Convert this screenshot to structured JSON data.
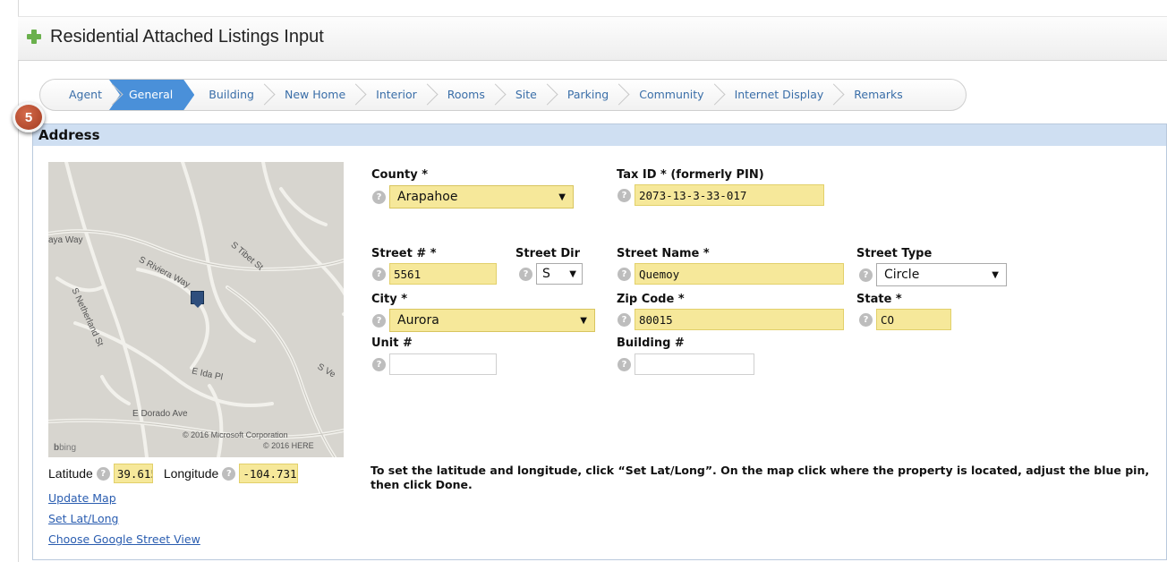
{
  "page": {
    "title": "Residential Attached Listings Input"
  },
  "tabs": [
    {
      "label": "Agent",
      "active": false
    },
    {
      "label": "General",
      "active": true
    },
    {
      "label": "Building",
      "active": false
    },
    {
      "label": "New Home",
      "active": false
    },
    {
      "label": "Interior",
      "active": false
    },
    {
      "label": "Rooms",
      "active": false
    },
    {
      "label": "Site",
      "active": false
    },
    {
      "label": "Parking",
      "active": false
    },
    {
      "label": "Community",
      "active": false
    },
    {
      "label": "Internet Display",
      "active": false
    },
    {
      "label": "Remarks",
      "active": false
    }
  ],
  "step_badge": "5",
  "section": {
    "title": "Address"
  },
  "map": {
    "labels": {
      "aya_way": "aya Way",
      "s_riviera_way": "S Riviera Way",
      "s_tibet_st": "S Tibet St",
      "s_netherland_st": "S Netherland St",
      "e_ida_pl": "E Ida Pl",
      "s_ve": "S Ve",
      "e_dorado_ave": "E Dorado Ave",
      "copyright_ms": "© 2016 Microsoft Corporation",
      "copyright_here": "© 2016 HERE",
      "bing": "bing"
    },
    "background_color": "#d7d5cf"
  },
  "fields": {
    "county": {
      "label": "County *",
      "value": "Arapahoe"
    },
    "tax_id": {
      "label": "Tax ID * (formerly PIN)",
      "value": "2073-13-3-33-017"
    },
    "street_num": {
      "label": "Street # *",
      "value": "5561"
    },
    "street_dir": {
      "label": "Street Dir",
      "value": "S"
    },
    "street_name": {
      "label": "Street Name *",
      "value": "Quemoy"
    },
    "street_type": {
      "label": "Street Type",
      "value": "Circle"
    },
    "city": {
      "label": "City *",
      "value": "Aurora"
    },
    "zip": {
      "label": "Zip Code *",
      "value": "80015"
    },
    "state": {
      "label": "State *",
      "value": "CO"
    },
    "unit": {
      "label": "Unit #",
      "value": ""
    },
    "building": {
      "label": "Building #",
      "value": ""
    }
  },
  "coords": {
    "lat_label": "Latitude",
    "lat_value": "39.6153",
    "lon_label": "Longitude",
    "lon_value": "-104.731"
  },
  "links": {
    "update_map": "Update Map",
    "set_lat_long": "Set Lat/Long",
    "street_view": "Choose Google Street View"
  },
  "instructions": "To set the latitude and longitude, click “Set Lat/Long”. On the map click where the property is located, adjust the blue pin, then click Done.",
  "help_glyph": "?",
  "caret_glyph": "▼",
  "colors": {
    "highlight": "#f6e89a",
    "tab_active": "#4a90d9",
    "link": "#2a5db0",
    "section_head": "#cfdff2"
  }
}
